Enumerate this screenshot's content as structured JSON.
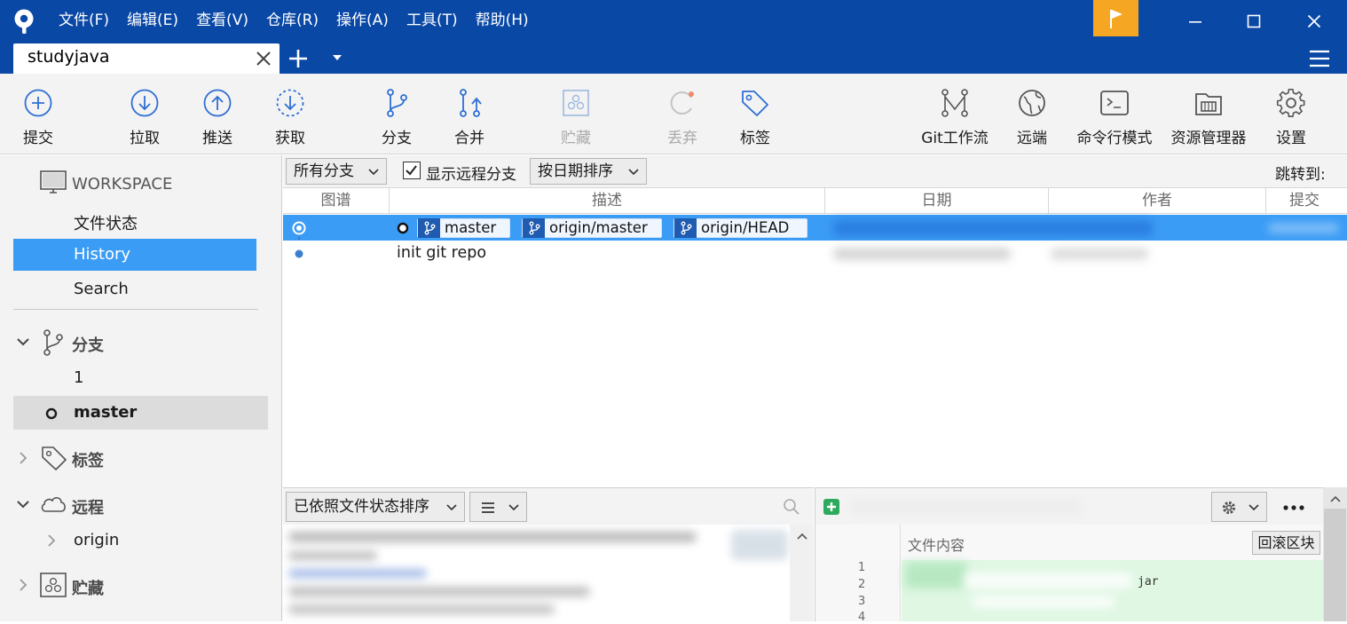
{
  "window": {
    "menu": [
      "文件(F)",
      "编辑(E)",
      "查看(V)",
      "仓库(R)",
      "操作(A)",
      "工具(T)",
      "帮助(H)"
    ]
  },
  "tabs": {
    "active_title": "studyjava"
  },
  "toolbar": {
    "commit": "提交",
    "pull": "拉取",
    "push": "推送",
    "fetch": "获取",
    "branch": "分支",
    "merge": "合并",
    "stash": "贮藏",
    "discard": "丢弃",
    "tag": "标签",
    "gitflow": "Git工作流",
    "remote": "远端",
    "terminal": "命令行模式",
    "explorer": "资源管理器",
    "settings": "设置"
  },
  "sidebar": {
    "workspace_title": "WORKSPACE",
    "file_status": "文件状态",
    "history": "History",
    "search": "Search",
    "branches_title": "分支",
    "branch_items": [
      "1",
      "master"
    ],
    "tags_title": "标签",
    "remotes_title": "远程",
    "remote_items": [
      "origin"
    ],
    "stash_title": "贮藏"
  },
  "filter": {
    "branches_select": "所有分支",
    "show_remote_label": "显示远程分支",
    "show_remote_checked": true,
    "sort_select": "按日期排序",
    "jump_label": "跳转到:"
  },
  "columns": {
    "graph": "图谱",
    "description": "描述",
    "date": "日期",
    "author": "作者",
    "commit": "提交"
  },
  "commits": [
    {
      "refs": [
        "master",
        "origin/master",
        "origin/HEAD"
      ]
    },
    {
      "message": "init git repo"
    }
  ],
  "bottom": {
    "sort_select": "已依照文件状态排序",
    "file_content_label": "文件内容",
    "revert_hunk_label": "回滚区块",
    "line_numbers": [
      "1",
      "2",
      "3",
      "4"
    ],
    "code_fragment": "jar"
  },
  "colors": {
    "titlebar": "#0a48a6",
    "selection": "#3b9cf5",
    "flag": "#f5a623",
    "ref_badge": "#1f5bb0"
  }
}
